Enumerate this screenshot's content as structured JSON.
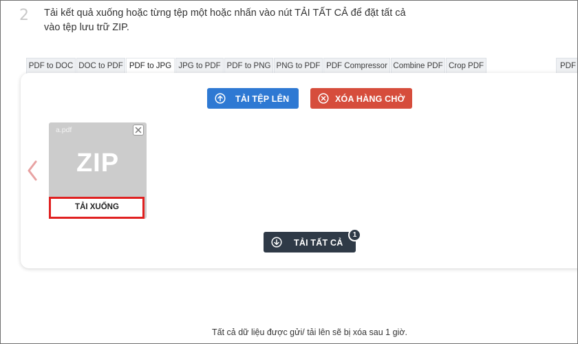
{
  "instruction": {
    "step_number": "2",
    "text": "Tải kết quả xuống hoặc từng tệp một hoặc nhấn vào nút TẢI TẤT CẢ để đặt tất cả vào tệp lưu trữ ZIP."
  },
  "tabs": [
    {
      "label": "PDF to DOC",
      "active": false
    },
    {
      "label": "DOC to PDF",
      "active": false
    },
    {
      "label": "PDF to JPG",
      "active": true
    },
    {
      "label": "JPG to PDF",
      "active": false
    },
    {
      "label": "PDF to PNG",
      "active": false
    },
    {
      "label": "PNG to PDF",
      "active": false
    },
    {
      "label": "PDF Compressor",
      "active": false
    },
    {
      "label": "Combine PDF",
      "active": false
    },
    {
      "label": "Crop PDF",
      "active": false
    },
    {
      "label": "PDF F",
      "active": false
    }
  ],
  "actions": {
    "upload_label": "TẢI TỆP LÊN",
    "clear_label": "XÓA HÀNG CHỜ",
    "download_all_label": "TẢI TẤT CẢ",
    "download_all_count": "1"
  },
  "file": {
    "name": "a.pdf",
    "type_label": "ZIP",
    "download_label": "TẢI XUỐNG"
  },
  "footer": {
    "note": "Tất cả dữ liệu được gửi/ tải lên sẽ bị xóa sau 1 giờ."
  },
  "colors": {
    "upload": "#2e79d3",
    "clear": "#d64d3c",
    "download_all": "#2f3a47",
    "highlight": "#e02020"
  },
  "icons": {
    "upload": "upload-circle-icon",
    "clear": "close-circle-icon",
    "download_all": "download-circle-icon",
    "prev": "chevron-left-icon",
    "file_close": "close-icon"
  }
}
